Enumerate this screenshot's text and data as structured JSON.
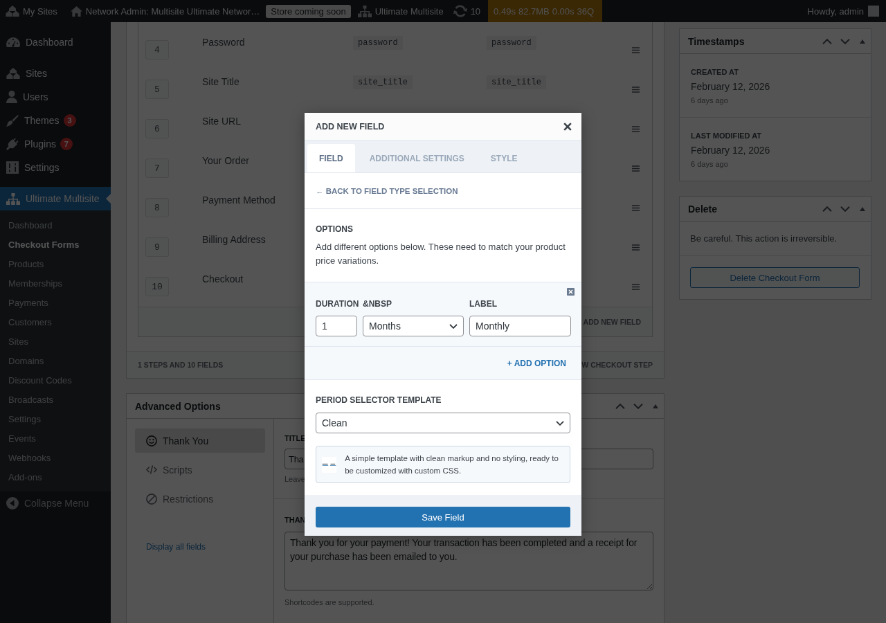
{
  "admin_bar": {
    "my_sites": "My Sites",
    "site_name": "Network Admin: Multisite Ultimate Networ…",
    "notice": "Store coming soon",
    "network": "Ultimate Multisite",
    "updates": "10",
    "stats": [
      "0.49s",
      "82.7MB",
      "0.00s",
      "36Q"
    ],
    "greeting": "Howdy, admin"
  },
  "sidebar": {
    "items": [
      {
        "label": "Dashboard",
        "selected": false
      },
      {
        "label": "Sites",
        "selected": false
      },
      {
        "label": "Users",
        "selected": false
      },
      {
        "label": "Themes",
        "badge": "3",
        "selected": false
      },
      {
        "label": "Plugins",
        "badge": "7",
        "selected": false
      },
      {
        "label": "Settings",
        "selected": false
      },
      {
        "label": "Ultimate Multisite",
        "selected": true,
        "children": [
          {
            "label": "Dashboard",
            "selected": false
          },
          {
            "label": "Checkout Forms",
            "selected": true
          },
          {
            "label": "Products",
            "selected": false
          },
          {
            "label": "Memberships",
            "selected": false
          },
          {
            "label": "Payments",
            "selected": false
          },
          {
            "label": "Customers",
            "selected": false
          },
          {
            "label": "Sites",
            "selected": false
          },
          {
            "label": "Domains",
            "selected": false
          },
          {
            "label": "Discount Codes",
            "selected": false
          },
          {
            "label": "Broadcasts",
            "selected": false
          },
          {
            "label": "Settings",
            "selected": false
          },
          {
            "label": "Events",
            "selected": false
          },
          {
            "label": "Webhooks",
            "selected": false
          },
          {
            "label": "Add-ons",
            "selected": false
          }
        ]
      }
    ],
    "collapse": "Collapse Menu"
  },
  "steps": {
    "rows": [
      {
        "number": "4",
        "name": "Password",
        "codes": [
          "password",
          "password"
        ]
      },
      {
        "number": "5",
        "name": "Site Title",
        "codes": [
          "site_title",
          "site_title"
        ]
      },
      {
        "number": "6",
        "name": "Site URL"
      },
      {
        "number": "7",
        "name": "Your Order"
      },
      {
        "number": "8",
        "name": "Payment Method"
      },
      {
        "number": "9",
        "name": "Billing Address"
      },
      {
        "number": "10",
        "name": "Checkout"
      }
    ],
    "add_field": "ADD NEW FIELD",
    "summary": "1 STEPS AND 10 FIELDS",
    "add_step": "W CHECKOUT STEP"
  },
  "advanced_options": {
    "title": "Advanced Options",
    "nav": [
      {
        "label": "Thank You",
        "selected": true
      },
      {
        "label": "Scripts",
        "selected": false
      },
      {
        "label": "Restrictions",
        "selected": false
      }
    ],
    "display_all": "Display all fields",
    "title_field": {
      "label": "TITLE",
      "value": "Tha",
      "hint": "Leave"
    },
    "message_field": {
      "label": "THAN",
      "value": "Thank you for your payment! Your transaction has been completed and a receipt for your purchase has been emailed to you.",
      "hint": "Shortcodes are supported."
    }
  },
  "timestamps": {
    "title": "Timestamps",
    "entries": [
      {
        "label": "CREATED AT",
        "date": "February 12, 2026",
        "ago": "6 days ago"
      },
      {
        "label": "LAST MODIFIED AT",
        "date": "February 12, 2026",
        "ago": "6 days ago"
      }
    ]
  },
  "delete_box": {
    "title": "Delete",
    "warning": "Be careful. This action is irreversible.",
    "button": "Delete Checkout Form"
  },
  "modal": {
    "title": "ADD NEW FIELD",
    "tabs": [
      {
        "label": "FIELD",
        "selected": true
      },
      {
        "label": "ADDITIONAL SETTINGS",
        "selected": false
      },
      {
        "label": "STYLE",
        "selected": false
      }
    ],
    "back_link": "← BACK TO FIELD TYPE SELECTION",
    "options": {
      "heading": "OPTIONS",
      "description": "Add different options below. These need to match your product price variations.",
      "columns": [
        "DURATION",
        "&NBSP",
        "LABEL"
      ],
      "rows": [
        {
          "duration": "1",
          "unit": "Months",
          "label": "Monthly"
        }
      ],
      "add_option": "+ ADD OPTION"
    },
    "template": {
      "label": "PERIOD SELECTOR TEMPLATE",
      "value": "Clean",
      "description": "A simple template with clean markup and no styling, ready to be customized with custom CSS."
    },
    "save_button": "Save Field"
  }
}
